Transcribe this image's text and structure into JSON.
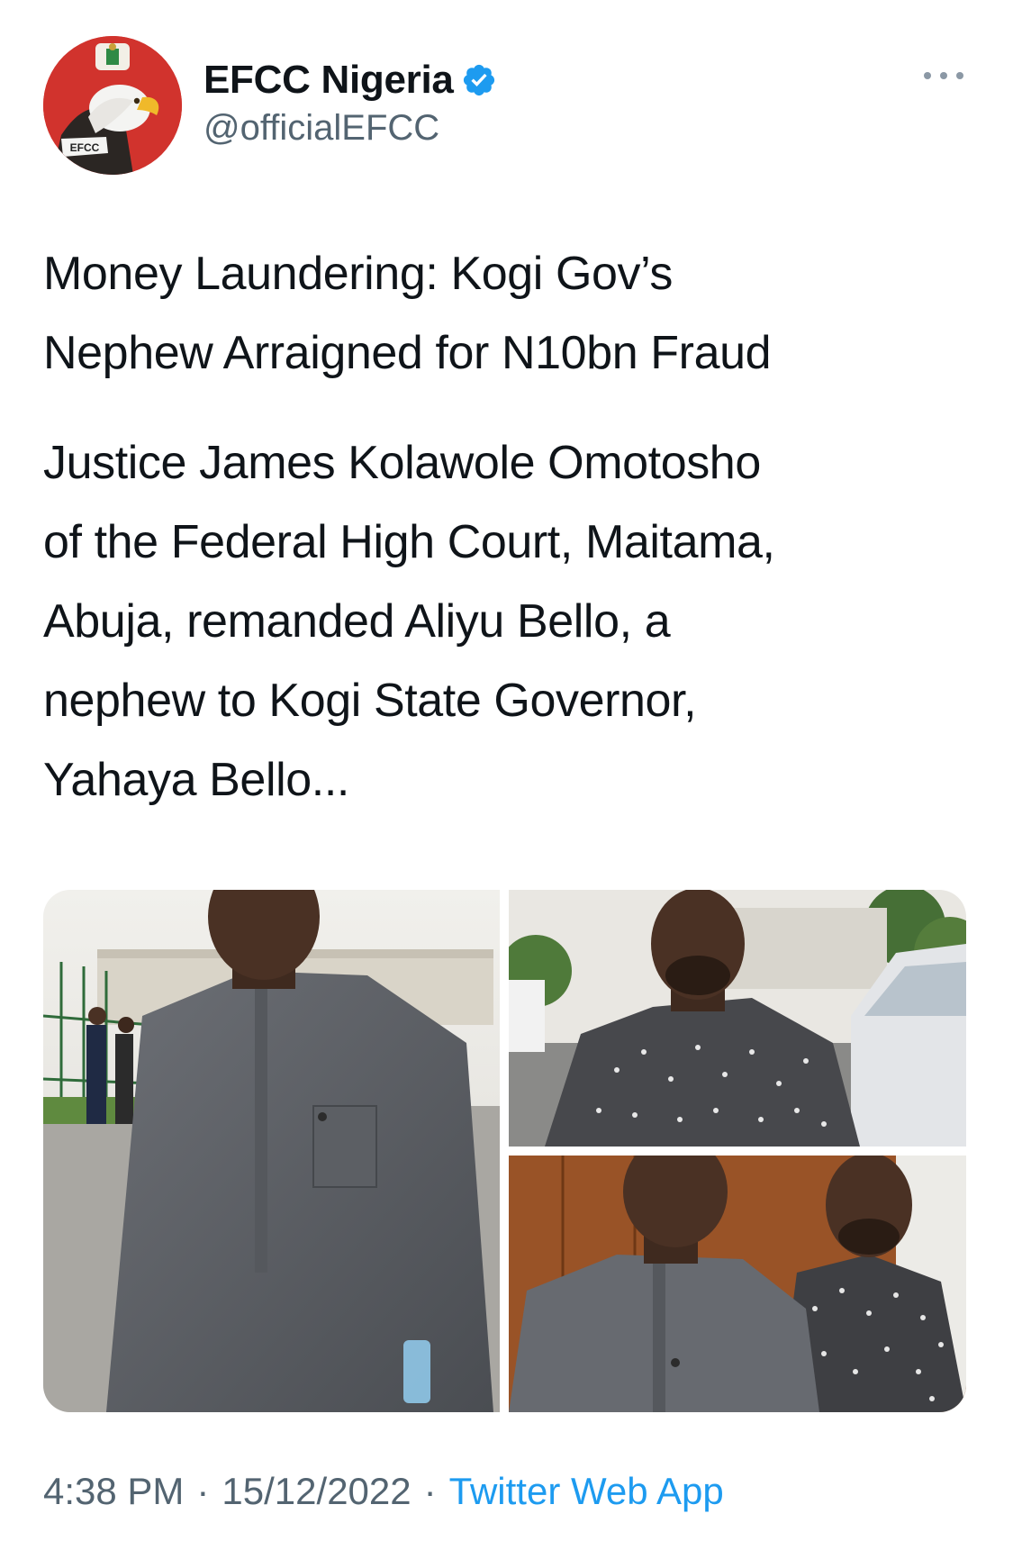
{
  "tweet": {
    "author": {
      "display_name": "EFCC Nigeria",
      "handle": "@officialEFCC",
      "avatar_icon": "efcc-eagle-logo",
      "avatar_badge_text": "EFCC",
      "verified": true,
      "verified_color": "#1d9bf0"
    },
    "menu_icon": "more-horizontal-icon",
    "headline": "Money Laundering: Kogi Gov’s\nNephew Arraigned for N10bn Fraud",
    "text": "Justice James Kolawole Omotosho\nof the Federal High Court, Maitama,\nAbuja, remanded Aliyu Bello, a\nnephew to Kogi State Governor,\nYahaya Bello...",
    "media": [
      {
        "kind": "photo",
        "subject": "man in grey kaftan walking outdoors"
      },
      {
        "kind": "photo",
        "subject": "man in patterned shirt outdoors near vans"
      },
      {
        "kind": "photo",
        "subject": "two men seated in courtroom"
      }
    ],
    "time": "4:38 PM",
    "separator": "·",
    "date": "15/12/2022",
    "source": "Twitter Web App"
  },
  "colors": {
    "text_primary": "#0f1419",
    "text_secondary": "#536471",
    "link": "#1d9bf0",
    "avatar_bg": "#d1332d"
  }
}
